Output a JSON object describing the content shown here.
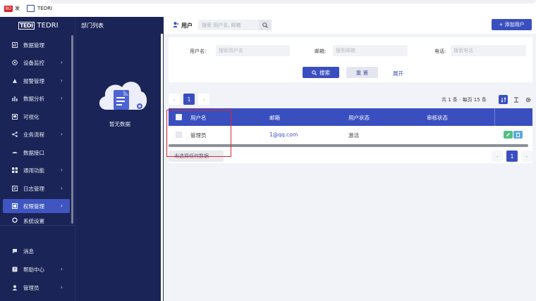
{
  "topbar": {
    "badge": "BD",
    "badge_text": "发",
    "tab_title": "TEDRI"
  },
  "brand": {
    "mark": "TEDI",
    "name": "TEDRI"
  },
  "sidebar": {
    "items": [
      {
        "label": "数据管理",
        "icon": "database-icon",
        "chevron": ""
      },
      {
        "label": "设备监控",
        "icon": "monitor-icon",
        "chevron": "›"
      },
      {
        "label": "报警管理",
        "icon": "alarm-icon",
        "chevron": "›"
      },
      {
        "label": "数据分析",
        "icon": "bar-chart-icon",
        "chevron": "›"
      },
      {
        "label": "可视化",
        "icon": "visual-icon",
        "chevron": ""
      },
      {
        "label": "业务流程",
        "icon": "flow-icon",
        "chevron": "›"
      },
      {
        "label": "数据接口",
        "icon": "interface-icon",
        "chevron": ""
      },
      {
        "label": "通用功能",
        "icon": "grid-icon",
        "chevron": "›"
      },
      {
        "label": "日志管理",
        "icon": "log-icon",
        "chevron": "›"
      },
      {
        "label": "权限管理",
        "icon": "permission-icon",
        "chevron": "›"
      },
      {
        "label": "系统设置",
        "icon": "settings-icon",
        "chevron": ""
      }
    ],
    "bottom": [
      {
        "label": "消息",
        "icon": "message-icon",
        "chevron": ""
      },
      {
        "label": "帮助中心",
        "icon": "help-icon",
        "chevron": "›"
      },
      {
        "label": "管理员",
        "icon": "user-icon",
        "chevron": "›"
      }
    ]
  },
  "dept": {
    "title": "部门列表",
    "empty_text": "暂无数据"
  },
  "header": {
    "title": "用户",
    "search_placeholder": "搜索 用户名, 邮箱",
    "add_button": "+ 添加用户"
  },
  "filter": {
    "username_label": "用户名:",
    "username_placeholder": "搜索用户名",
    "email_label": "邮箱:",
    "email_placeholder": "搜索邮箱",
    "phone_label": "电话:",
    "phone_placeholder": "搜索电话",
    "search_button": "搜索",
    "reset_button": "重 置",
    "expand_link": "展开"
  },
  "pagination": {
    "current": "1",
    "prev": "‹",
    "next": "›",
    "summary": "共 1 条 · 每页 15 条"
  },
  "table": {
    "columns": [
      "用户名",
      "邮箱",
      "用户状态",
      "审核状态"
    ],
    "rows": [
      {
        "username": "管理员",
        "email": "1@qq.com",
        "status": "激活",
        "audit": ""
      }
    ]
  },
  "footer": {
    "selection_text": "未选择任何数据"
  },
  "colors": {
    "sidebar_bg": "#1b2456",
    "primary": "#3a4fbf",
    "highlight_border": "#e0262f"
  }
}
